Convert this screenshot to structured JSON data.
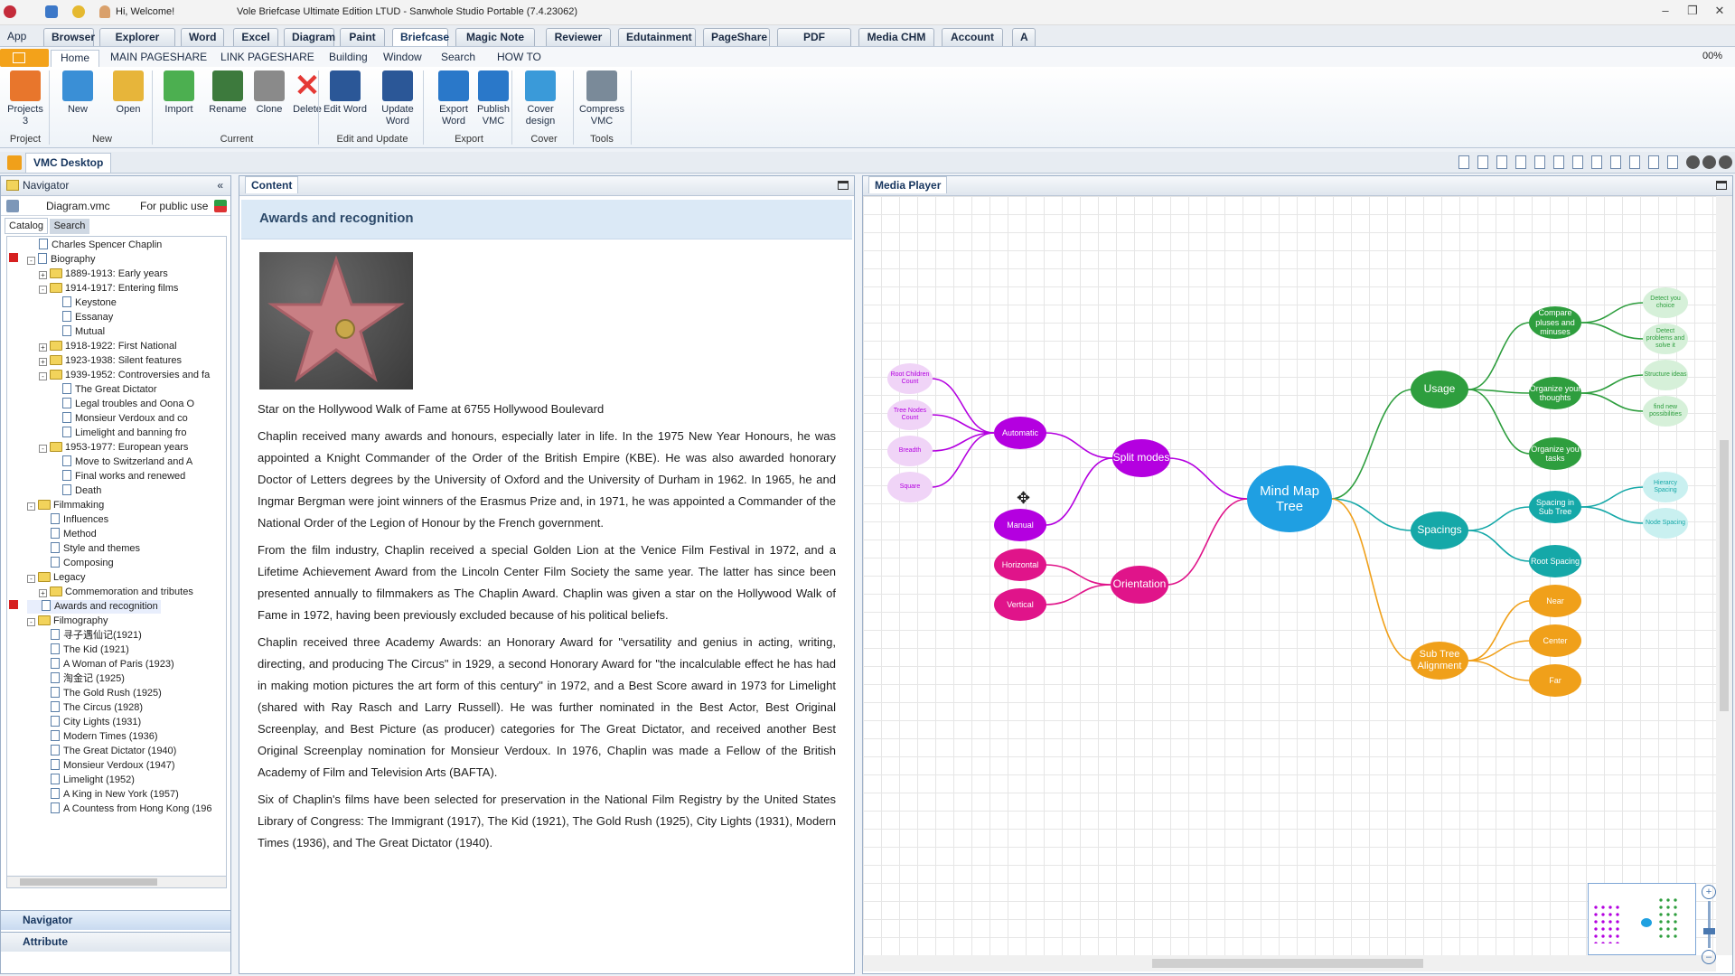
{
  "titlebar": {
    "welcome": "Hi, Welcome!",
    "title": "Vole Briefcase Ultimate Edition LTUD - Sanwhole Studio Portable (7.4.23062)"
  },
  "app_tabs": [
    "App",
    "Browser",
    "Explorer",
    "Word",
    "Excel",
    "Diagram",
    "Paint",
    "Briefcase",
    "Magic Note",
    "Reviewer",
    "Edutainment",
    "PageShare",
    "PDF Creator",
    "Media CHM",
    "Account",
    "A"
  ],
  "ribbon_tabs": [
    "Home",
    "MAIN PAGESHARE",
    "LINK PAGESHARE",
    "Building",
    "Window",
    "Search",
    "HOW TO"
  ],
  "zoom": "00%",
  "ribbon": {
    "buttons": [
      {
        "label": "Projects\n3",
        "color": "#e8762c"
      },
      {
        "label": "New",
        "color": "#3a8fd6"
      },
      {
        "label": "Open",
        "color": "#e7b53a"
      },
      {
        "label": "Import",
        "color": "#4caf50"
      },
      {
        "label": "Rename",
        "color": "#3d7a3d"
      },
      {
        "label": "Clone",
        "color": "#8a8a8a"
      },
      {
        "label": "Delete",
        "color": "#e53935"
      },
      {
        "label": "Edit Word",
        "color": "#2b5797"
      },
      {
        "label": "Update\nWord",
        "color": "#2b5797"
      },
      {
        "label": "Export\nWord",
        "color": "#2a78c9"
      },
      {
        "label": "Publish\nVMC",
        "color": "#2a78c9"
      },
      {
        "label": "Cover\ndesign",
        "color": "#3a9ad9"
      },
      {
        "label": "Compress\nVMC",
        "color": "#7a8a99"
      }
    ],
    "groups": [
      "Project",
      "New",
      "Current",
      "Edit and Update",
      "Export",
      "Cover",
      "Tools"
    ]
  },
  "desktop": {
    "title": "VMC Desktop"
  },
  "navigator": {
    "header": "Navigator",
    "file": "Diagram.vmc",
    "visibility": "For public use",
    "tabs": [
      "Catalog",
      "Search"
    ],
    "tree": [
      {
        "label": "Charles Spencer Chaplin",
        "lvl": 0,
        "kind": "page"
      },
      {
        "label": "Biography",
        "lvl": 0,
        "kind": "page",
        "exp": "-"
      },
      {
        "label": "1889-1913: Early years",
        "lvl": 1,
        "kind": "folder",
        "exp": "+"
      },
      {
        "label": "1914-1917: Entering films",
        "lvl": 1,
        "kind": "folder",
        "exp": "-"
      },
      {
        "label": "Keystone",
        "lvl": 2,
        "kind": "page"
      },
      {
        "label": "Essanay",
        "lvl": 2,
        "kind": "page"
      },
      {
        "label": "Mutual",
        "lvl": 2,
        "kind": "page"
      },
      {
        "label": "1918-1922: First National",
        "lvl": 1,
        "kind": "folder",
        "exp": "+"
      },
      {
        "label": "1923-1938: Silent features",
        "lvl": 1,
        "kind": "folder",
        "exp": "+"
      },
      {
        "label": "1939-1952: Controversies and fa",
        "lvl": 1,
        "kind": "folder",
        "exp": "-"
      },
      {
        "label": "The Great Dictator",
        "lvl": 2,
        "kind": "page"
      },
      {
        "label": "Legal troubles and Oona O",
        "lvl": 2,
        "kind": "page"
      },
      {
        "label": "Monsieur Verdoux and co",
        "lvl": 2,
        "kind": "page"
      },
      {
        "label": "Limelight and banning fro",
        "lvl": 2,
        "kind": "page"
      },
      {
        "label": "1953-1977: European years",
        "lvl": 1,
        "kind": "folder",
        "exp": "-"
      },
      {
        "label": "Move to Switzerland and A",
        "lvl": 2,
        "kind": "page"
      },
      {
        "label": "Final works and renewed",
        "lvl": 2,
        "kind": "page"
      },
      {
        "label": "Death",
        "lvl": 2,
        "kind": "page"
      },
      {
        "label": "Filmmaking",
        "lvl": 0,
        "kind": "folder",
        "exp": "-"
      },
      {
        "label": "Influences",
        "lvl": 1,
        "kind": "page"
      },
      {
        "label": "Method",
        "lvl": 1,
        "kind": "page"
      },
      {
        "label": "Style and themes",
        "lvl": 1,
        "kind": "page"
      },
      {
        "label": "Composing",
        "lvl": 1,
        "kind": "page"
      },
      {
        "label": "Legacy",
        "lvl": 0,
        "kind": "folder",
        "exp": "-"
      },
      {
        "label": "Commemoration and tributes",
        "lvl": 1,
        "kind": "folder",
        "exp": "+"
      },
      {
        "label": "Awards and recognition",
        "lvl": 0,
        "kind": "page",
        "sel": true
      },
      {
        "label": "Filmography",
        "lvl": 0,
        "kind": "folder",
        "exp": "-"
      },
      {
        "label": "寻子遇仙记(1921)",
        "lvl": 1,
        "kind": "page"
      },
      {
        "label": "The Kid (1921)",
        "lvl": 1,
        "kind": "page"
      },
      {
        "label": "A Woman of Paris (1923)",
        "lvl": 1,
        "kind": "page"
      },
      {
        "label": "淘金记 (1925)",
        "lvl": 1,
        "kind": "page"
      },
      {
        "label": "The Gold Rush (1925)",
        "lvl": 1,
        "kind": "page"
      },
      {
        "label": "The Circus (1928)",
        "lvl": 1,
        "kind": "page"
      },
      {
        "label": "City Lights (1931)",
        "lvl": 1,
        "kind": "page"
      },
      {
        "label": "Modern Times (1936)",
        "lvl": 1,
        "kind": "page"
      },
      {
        "label": "The Great Dictator (1940)",
        "lvl": 1,
        "kind": "page"
      },
      {
        "label": "Monsieur Verdoux (1947)",
        "lvl": 1,
        "kind": "page"
      },
      {
        "label": "Limelight (1952)",
        "lvl": 1,
        "kind": "page"
      },
      {
        "label": "A King in New York (1957)",
        "lvl": 1,
        "kind": "page"
      },
      {
        "label": "A Countess from Hong Kong (196",
        "lvl": 1,
        "kind": "page"
      }
    ],
    "bottom": [
      "Navigator",
      "Attribute"
    ]
  },
  "content": {
    "header": "Content",
    "title": "Awards and recognition",
    "caption": "Star on the Hollywood Walk of Fame at 6755 Hollywood Boulevard",
    "paragraphs": [
      "Chaplin received many awards and honours, especially later in life. In the 1975 New Year Honours, he was appointed a Knight Commander of the Order of the British Empire (KBE). He was also awarded honorary Doctor of Letters degrees by the University of Oxford and the University of Durham in 1962. In 1965, he and Ingmar Bergman were joint winners of the Erasmus Prize and, in 1971, he was appointed a Commander of the National Order of the Legion of Honour by the French government.",
      "From the film industry, Chaplin received a special Golden Lion at the Venice Film Festival in 1972, and a Lifetime Achievement Award from the Lincoln Center Film Society the same year. The latter has since been presented annually to filmmakers as The Chaplin Award. Chaplin was given a star on the Hollywood Walk of Fame in 1972, having been previously excluded because of his political beliefs.",
      "Chaplin received three Academy Awards: an Honorary Award for \"versatility and genius in acting, writing, directing, and producing The Circus\" in 1929, a second Honorary Award for \"the incalculable effect he has had in making motion pictures the art form of this century\" in 1972, and a Best Score award in 1973 for Limelight (shared with Ray Rasch and Larry Russell). He was further nominated in the Best Actor, Best Original Screenplay, and Best Picture (as producer) categories for The Great Dictator, and received another Best Original Screenplay nomination for Monsieur Verdoux. In 1976, Chaplin was made a Fellow of the British Academy of Film and Television Arts (BAFTA).",
      "Six of Chaplin's films have been selected for preservation in the National Film Registry by the United States Library of Congress: The Immigrant (1917), The Kid (1921), The Gold Rush (1925), City Lights (1931), Modern Times (1936), and The Great Dictator (1940)."
    ]
  },
  "media": {
    "header": "Media Player",
    "mindmap": {
      "root": "Mind Map Tree",
      "branches": [
        {
          "label": "Usage",
          "color": "#2e9e3e",
          "children": [
            {
              "label": "Compare pluses and minuses",
              "leaves": [
                "Detect you choice",
                "Detect problems and solve it"
              ]
            },
            {
              "label": "Organize your thoughts",
              "leaves": [
                "Structure ideas",
                "find new possibilities"
              ]
            },
            {
              "label": "Organize you tasks",
              "leaves": []
            }
          ]
        },
        {
          "label": "Spacings",
          "color": "#15a8a8",
          "children": [
            {
              "label": "Spacing in Sub Tree",
              "leaves": [
                "Hierarcy Spacing",
                "Node Spacing"
              ]
            },
            {
              "label": "Root Spacing",
              "leaves": []
            }
          ]
        },
        {
          "label": "Sub Tree Alignment",
          "color": "#f0a01a",
          "children": [
            {
              "label": "Near",
              "leaves": []
            },
            {
              "label": "Center",
              "leaves": []
            },
            {
              "label": "Far",
              "leaves": []
            }
          ]
        },
        {
          "label": "Split modes",
          "color": "#b400e0",
          "children": [
            {
              "label": "Automatic",
              "leaves": [
                "Root Children Count",
                "Tree Nodes Count",
                "Breadth",
                "Square"
              ]
            },
            {
              "label": "Manual",
              "leaves": []
            }
          ]
        },
        {
          "label": "Orientation",
          "color": "#e0148a",
          "children": [
            {
              "label": "Horizontal",
              "leaves": []
            },
            {
              "label": "Vertical",
              "leaves": []
            }
          ]
        }
      ]
    }
  }
}
